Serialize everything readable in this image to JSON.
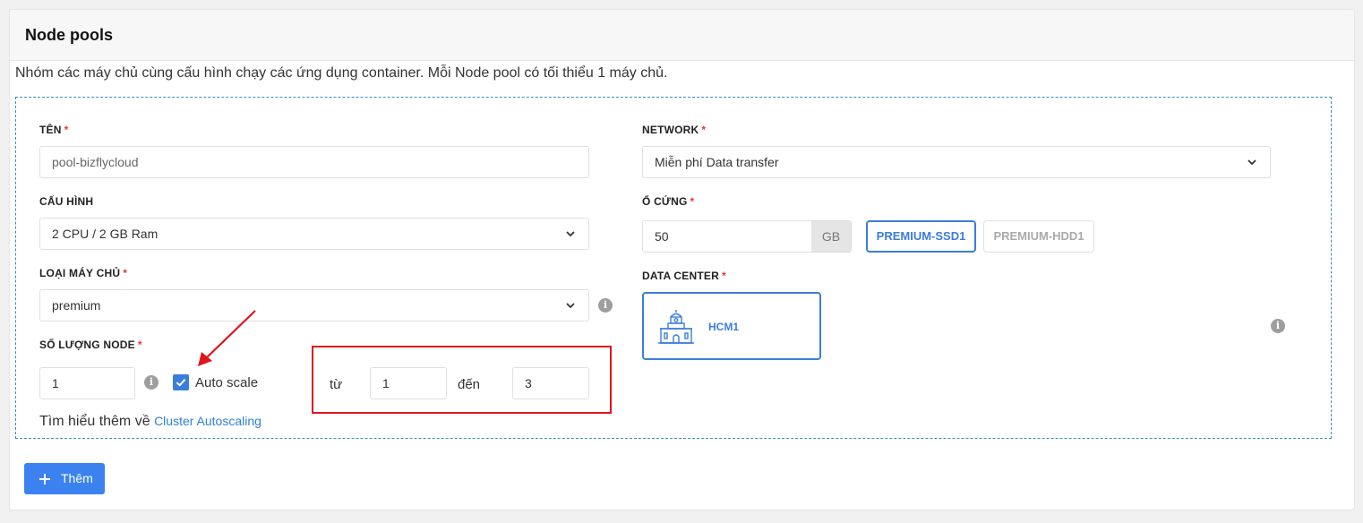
{
  "header": {
    "title": "Node pools"
  },
  "description": "Nhóm các máy chủ cùng cấu hình chạy các ứng dụng container. Mỗi Node pool có tối thiểu 1 máy chủ.",
  "form": {
    "name": {
      "label": "TÊN",
      "required": "*",
      "value": "pool-bizflycloud"
    },
    "config": {
      "label": "CẤU HÌNH",
      "value": "2 CPU / 2 GB Ram"
    },
    "server_type": {
      "label": "LOẠI MÁY CHỦ",
      "required": "*",
      "value": "premium"
    },
    "node_count": {
      "label": "SỐ LƯỢNG NODE",
      "required": "*",
      "value": "1",
      "autoscale_label": "Auto scale",
      "autoscale_checked": true,
      "from_label": "từ",
      "from_value": "1",
      "to_label": "đến",
      "to_value": "3"
    },
    "learn_more": {
      "text": "Tìm hiểu thêm về",
      "link": "Cluster Autoscaling"
    },
    "network": {
      "label": "NETWORK",
      "required": "*",
      "value": "Miễn phí Data transfer"
    },
    "disk": {
      "label": "Ổ CỨNG",
      "required": "*",
      "value": "50",
      "unit": "GB",
      "types": [
        {
          "label": "PREMIUM-SSD1",
          "active": true
        },
        {
          "label": "PREMIUM-HDD1",
          "active": false
        }
      ]
    },
    "datacenter": {
      "label": "DATA CENTER",
      "required": "*",
      "selected": "HCM1"
    }
  },
  "actions": {
    "add_label": "Thêm"
  },
  "icons": {
    "info": "info-icon",
    "chevron": "chevron-down-icon",
    "check": "check-icon",
    "plus": "plus-icon",
    "datacenter": "building-icon"
  },
  "colors": {
    "accent": "#3b7ddd",
    "required": "#e53935",
    "annotation": "#e0151b",
    "primary_button": "#3b82f0"
  }
}
